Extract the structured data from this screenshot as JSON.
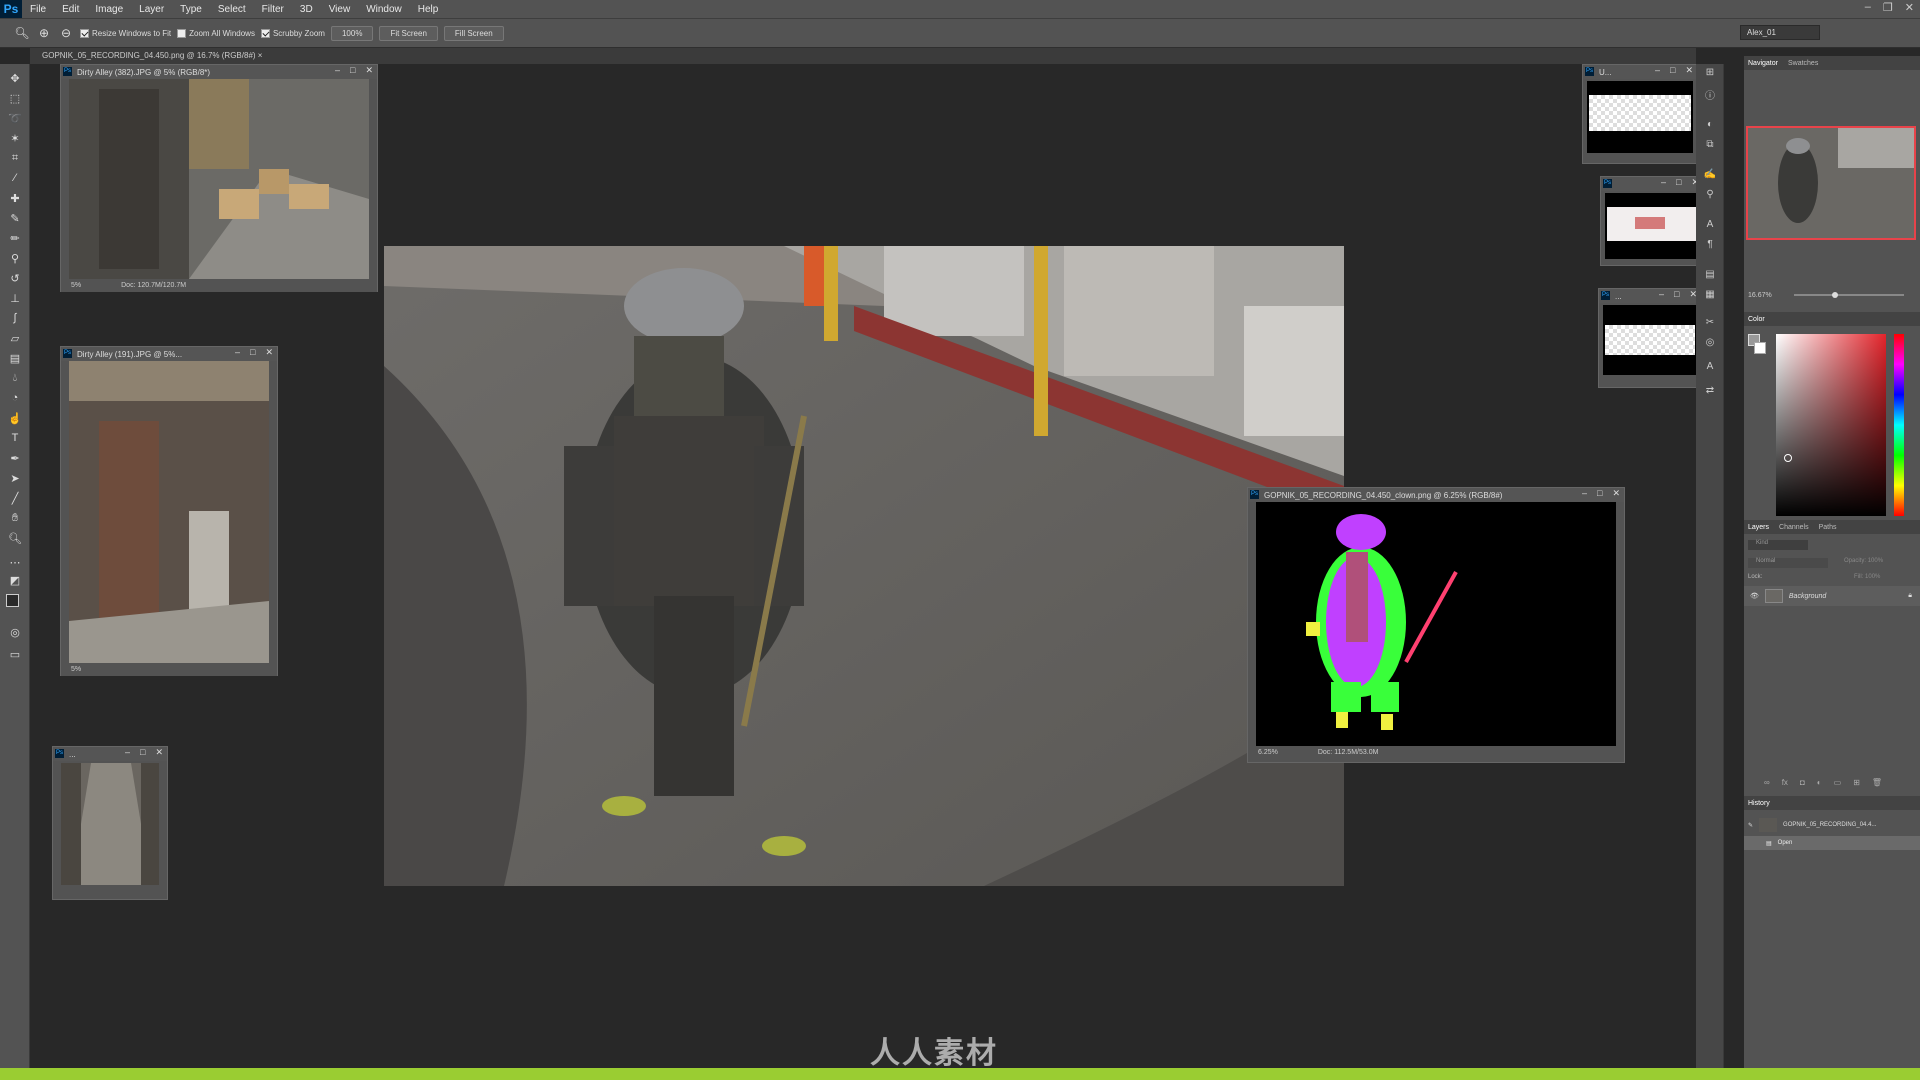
{
  "app": {
    "logo": "Ps"
  },
  "menu": [
    "File",
    "Edit",
    "Image",
    "Layer",
    "Type",
    "Select",
    "Filter",
    "3D",
    "View",
    "Window",
    "Help"
  ],
  "options": {
    "resize_windows": "Resize Windows to Fit",
    "zoom_all": "Zoom All Windows",
    "scrubby": "Scrubby Zoom",
    "btn_100": "100%",
    "btn_fit": "Fit Screen",
    "btn_fill": "Fill Screen",
    "workspace": "Alex_01"
  },
  "tab": {
    "label": "GOPNIK_05_RECORDING_04.450.png @ 16.7% (RGB/8#)",
    "close": "×"
  },
  "docs": {
    "alley382": {
      "title": "Dirty Alley (382).JPG @ 5% (RGB/8*)",
      "zoom": "5%",
      "info": "Doc: 120.7M/120.7M"
    },
    "alley191": {
      "title": "Dirty Alley (191).JPG @ 5%...",
      "zoom": "5%"
    },
    "small": {
      "title": "..."
    },
    "clown": {
      "title": "GOPNIK_05_RECORDING_04.450_clown.png @ 6.25% (RGB/8#)",
      "zoom": "6.25%",
      "info": "Doc: 112.5M/53.0M"
    },
    "u1": {
      "title": "U..."
    },
    "u2": {
      "title": ""
    },
    "u3": {
      "title": "..."
    }
  },
  "panels": {
    "navigator_tab": "Navigator",
    "swatches_tab": "Swatches",
    "nav_zoom": "16.67%",
    "color_tab": "Color",
    "layers_tab": "Layers",
    "channels_tab": "Channels",
    "paths_tab": "Paths",
    "kind": "Kind",
    "blend": "Normal",
    "opacity": "Opacity:",
    "opacity_val": "100%",
    "lock": "Lock:",
    "fill": "Fill:",
    "fill_val": "100%",
    "layer_name": "Background",
    "history_tab": "History",
    "history_snapshot": "GOPNIK_05_RECORDING_04.4...",
    "history_open": "Open"
  },
  "watermark": "人人素材",
  "colors": {
    "accent_red": "#e8434a",
    "ui_bg": "#535353",
    "canvas_bg": "#282828"
  }
}
